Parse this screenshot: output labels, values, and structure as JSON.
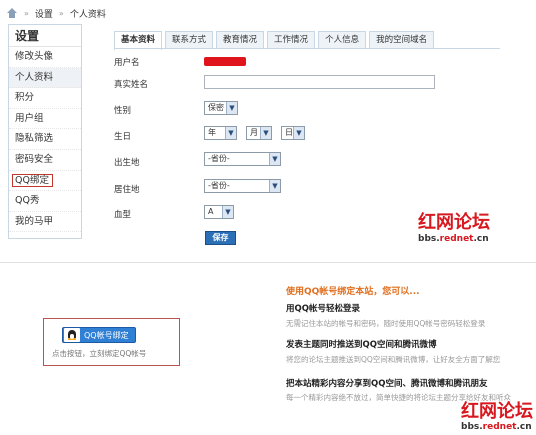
{
  "breadcrumb": {
    "items": [
      "设置",
      "个人资料"
    ]
  },
  "sidebar": {
    "title": "设置",
    "items": [
      "修改头像",
      "个人资料",
      "积分",
      "用户组",
      "隐私筛选",
      "密码安全",
      "QQ绑定",
      "QQ秀",
      "我的马甲"
    ]
  },
  "tabs": [
    "基本资料",
    "联系方式",
    "教育情况",
    "工作情况",
    "个人信息",
    "我的空间域名"
  ],
  "form": {
    "username_label": "用户名",
    "realname_label": "真实姓名",
    "realname_value": "",
    "gender_label": "性别",
    "gender_value": "保密",
    "birthday_label": "生日",
    "birth_year": "年",
    "birth_month": "月",
    "birth_day": "日",
    "birthplace_label": "出生地",
    "birthplace_value": "-省份-",
    "residence_label": "居住地",
    "residence_value": "-省份-",
    "blood_label": "血型",
    "blood_value": "A",
    "save_label": "保存"
  },
  "watermark": {
    "logo": "红网论坛",
    "url_prefix": "bbs.",
    "url_brand": "rednet",
    "url_suffix": ".cn"
  },
  "qq": {
    "bind_button": "QQ帐号绑定",
    "hint": "点击按钮，立刻绑定QQ帐号"
  },
  "info": {
    "title": "使用QQ帐号绑定本站，您可以...",
    "items": [
      {
        "head": "用QQ帐号轻松登录",
        "desc": "无需记住本站的帐号和密码，随时使用QQ帐号密码轻松登录"
      },
      {
        "head": "发表主题同时推送到QQ空间和腾讯微博",
        "desc": "将您的论坛主题推送到QQ空间和腾讯微博，让好友全方面了解您"
      },
      {
        "head": "把本站精彩内容分享到QQ空间、腾讯微博和腾讯朋友",
        "desc": "每一个精彩内容绝不放过，简单快捷的将论坛主题分享给好友和听众"
      }
    ]
  },
  "colors": {
    "accent": "#2b6fb6",
    "brand_red": "#d7181f",
    "orange": "#e07020"
  }
}
